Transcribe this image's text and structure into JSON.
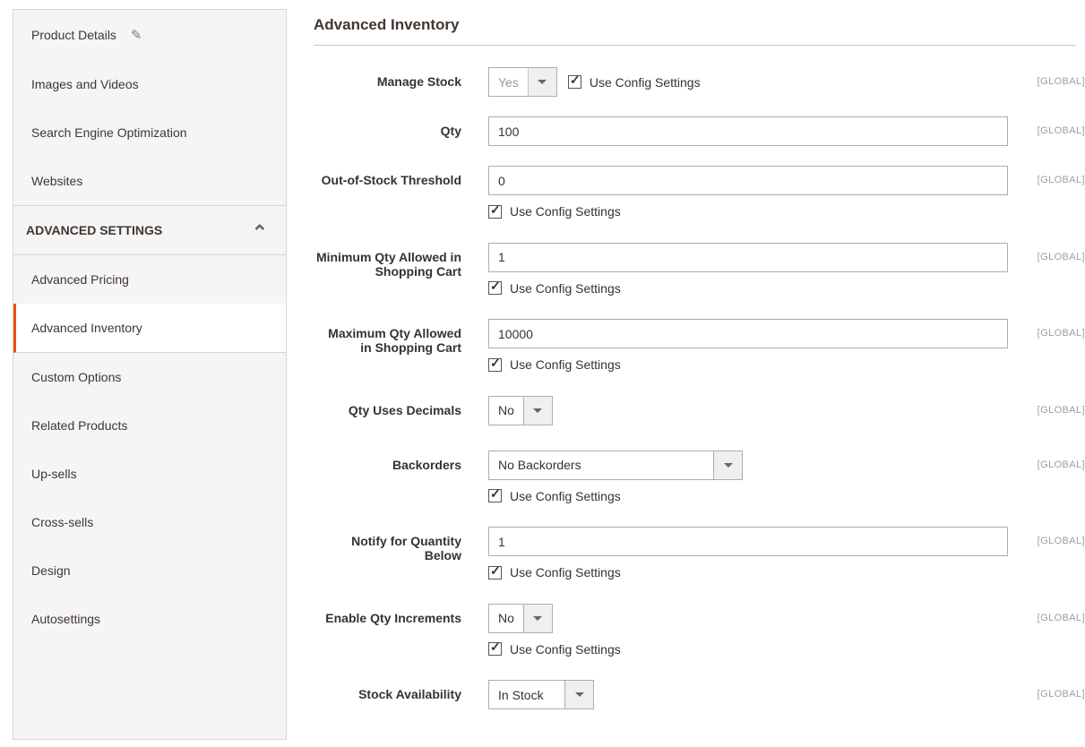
{
  "sidebar": {
    "basic": {
      "items": [
        {
          "label": "Product Details",
          "has_pencil": true
        },
        {
          "label": "Images and Videos"
        },
        {
          "label": "Search Engine Optimization"
        },
        {
          "label": "Websites"
        }
      ]
    },
    "advanced_header": "Advanced Settings",
    "advanced": {
      "items": [
        {
          "label": "Advanced Pricing"
        },
        {
          "label": "Advanced Inventory",
          "active": true
        },
        {
          "label": "Custom Options"
        },
        {
          "label": "Related Products"
        },
        {
          "label": "Up-sells"
        },
        {
          "label": "Cross-sells"
        },
        {
          "label": "Design"
        },
        {
          "label": "Autosettings"
        }
      ]
    }
  },
  "page": {
    "title": "Advanced Inventory"
  },
  "form": {
    "manage_stock": {
      "label": "Manage Stock",
      "value": "Yes",
      "use_config_label": "Use Config Settings",
      "scope": "[GLOBAL]"
    },
    "qty": {
      "label": "Qty",
      "value": "100",
      "scope": "[GLOBAL]"
    },
    "oos_threshold": {
      "label": "Out-of-Stock Threshold",
      "value": "0",
      "use_config_label": "Use Config Settings",
      "scope": "[GLOBAL]"
    },
    "min_qty": {
      "label": "Minimum Qty Allowed in Shopping Cart",
      "value": "1",
      "use_config_label": "Use Config Settings",
      "scope": "[GLOBAL]"
    },
    "max_qty": {
      "label": "Maximum Qty Allowed in Shopping Cart",
      "value": "10000",
      "use_config_label": "Use Config Settings",
      "scope": "[GLOBAL]"
    },
    "decimals": {
      "label": "Qty Uses Decimals",
      "value": "No",
      "scope": "[GLOBAL]"
    },
    "backorders": {
      "label": "Backorders",
      "value": "No Backorders",
      "use_config_label": "Use Config Settings",
      "scope": "[GLOBAL]"
    },
    "notify": {
      "label": "Notify for Quantity Below",
      "value": "1",
      "use_config_label": "Use Config Settings",
      "scope": "[GLOBAL]"
    },
    "increments": {
      "label": "Enable Qty Increments",
      "value": "No",
      "use_config_label": "Use Config Settings",
      "scope": "[GLOBAL]"
    },
    "availability": {
      "label": "Stock Availability",
      "value": "In Stock",
      "scope": "[GLOBAL]"
    }
  }
}
